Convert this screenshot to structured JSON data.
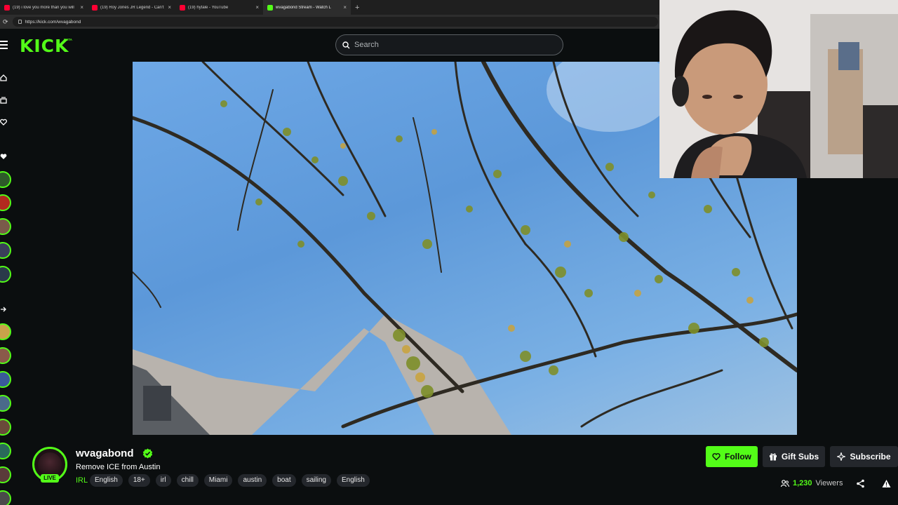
{
  "browser": {
    "tabs": [
      {
        "title": "(19) i love you more than you will",
        "favicon_color": "#ff0033",
        "active": false
      },
      {
        "title": "(19) Roy Jones JR Legend - Can't",
        "favicon_color": "#ff0033",
        "active": false
      },
      {
        "title": "(19) hytale - YouTube",
        "favicon_color": "#ff0033",
        "active": false
      },
      {
        "title": "wvagabond Stream - Watch L",
        "favicon_color": "#53fc18",
        "active": true
      }
    ],
    "new_tab": "+",
    "tab_close": "×",
    "url": "https://kick.com/wvagabond"
  },
  "header": {
    "logo": "KICK",
    "logo_badge": "BETA",
    "search_placeholder": "Search"
  },
  "sidebar": {
    "icons": [
      "home-icon",
      "browse-icon",
      "following-icon",
      "heart-icon",
      "collapse-icon"
    ],
    "avatar_count": 11
  },
  "channel": {
    "name": "wvagabond",
    "live_label": "LIVE",
    "stream_title": "Remove ICE from Austin",
    "category": "IRL",
    "tags": [
      "English",
      "18+",
      "irl",
      "chill",
      "Miami",
      "austin",
      "boat",
      "sailing",
      "English"
    ]
  },
  "actions": {
    "follow": "Follow",
    "gift": "Gift Subs",
    "subscribe": "Subscribe"
  },
  "stats": {
    "viewer_count": "1,230",
    "viewer_label": "Viewers"
  },
  "colors": {
    "accent": "#53fc18",
    "background": "#0b0e0f",
    "chip": "#24272c"
  }
}
